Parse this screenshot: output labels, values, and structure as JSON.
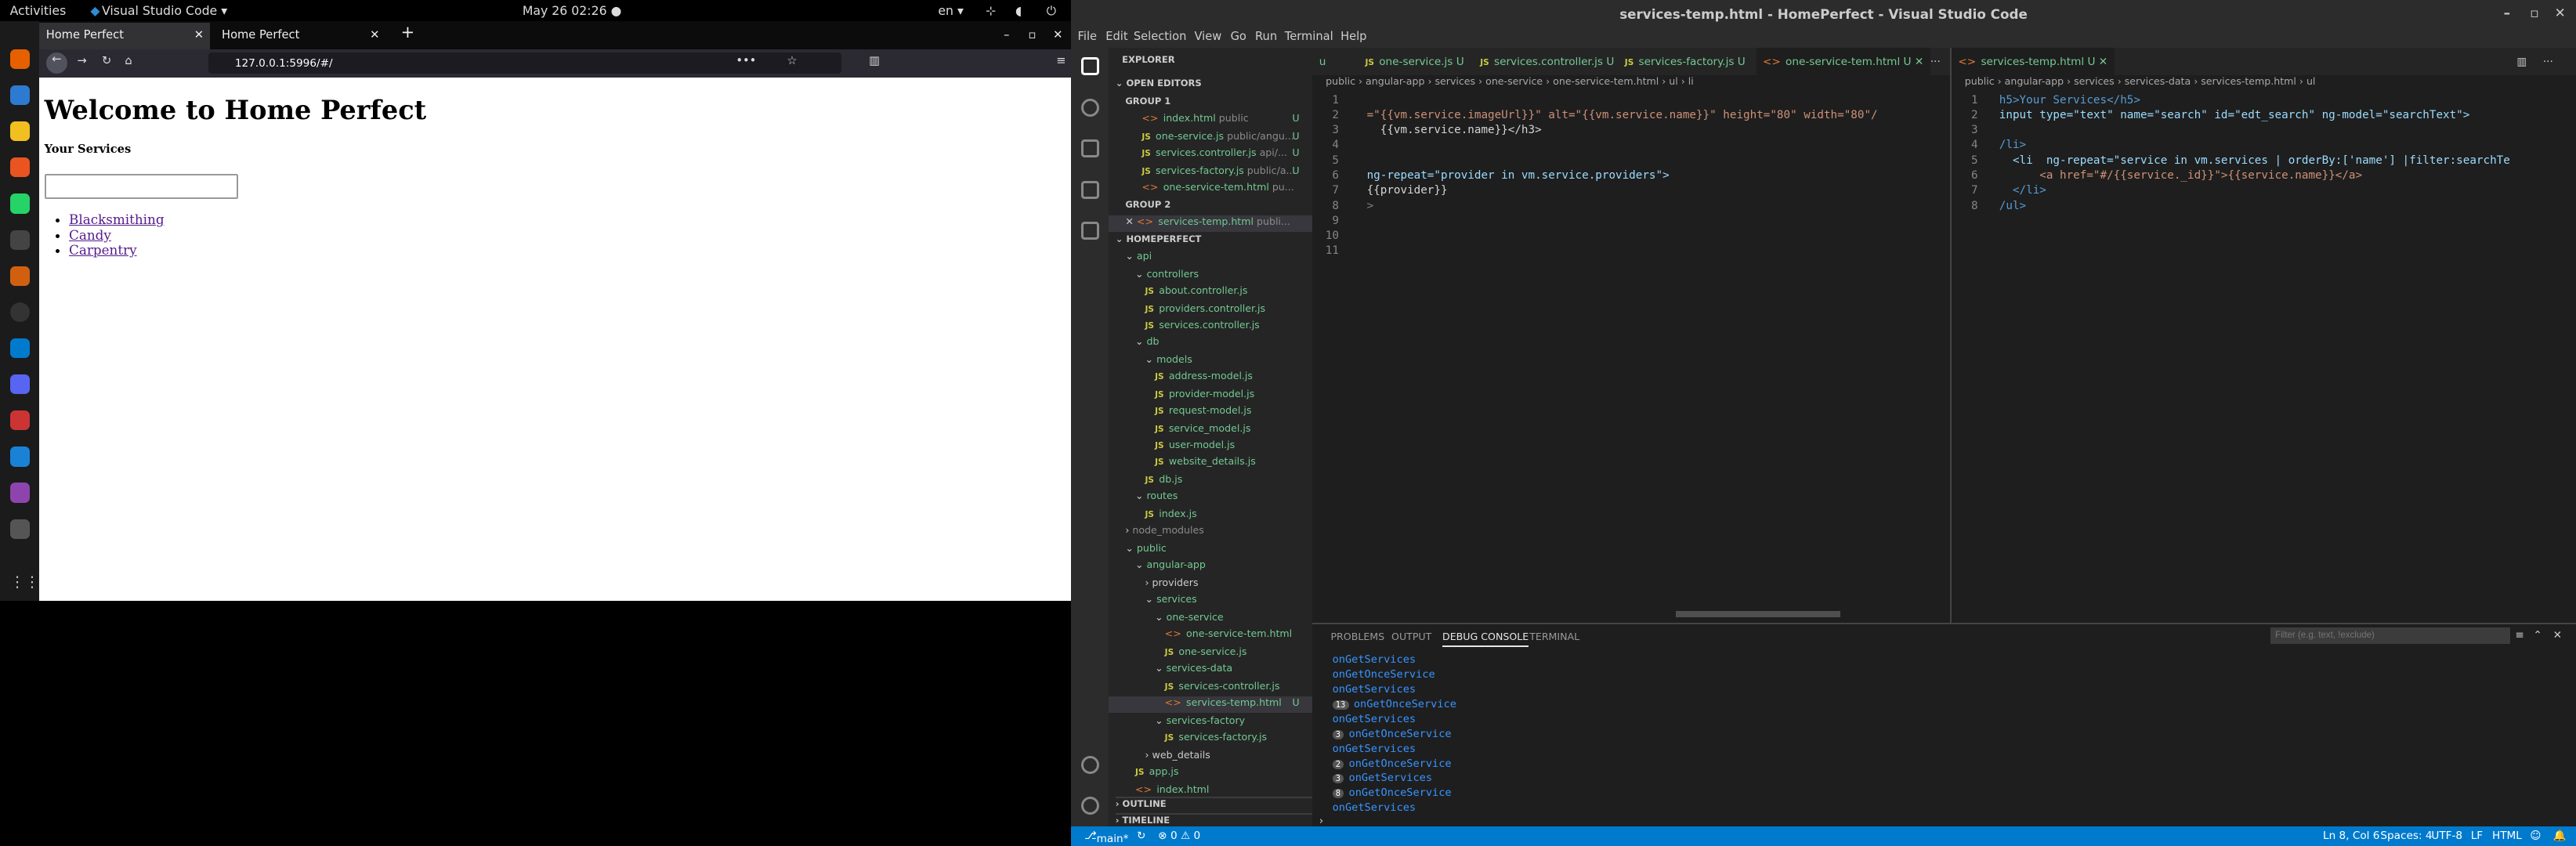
{
  "topbar": {
    "activities": "Activities",
    "app": "Visual Studio Code ▾",
    "clock": "May 26  02:26  ●",
    "lang": "en ▾"
  },
  "firefox": {
    "tabs": [
      "Home Perfect",
      "Home Perfect"
    ],
    "url": "127.0.0.1:5996/#/",
    "page": {
      "title": "Welcome to Home Perfect",
      "subtitle": "Your Services",
      "search_value": "",
      "items": [
        "Blacksmithing",
        "Candy",
        "Carpentry"
      ]
    }
  },
  "vscode": {
    "title": "services-temp.html - HomePerfect - Visual Studio Code",
    "menu": [
      "File",
      "Edit",
      "Selection",
      "View",
      "Go",
      "Run",
      "Terminal",
      "Help"
    ],
    "explorer": {
      "header": "EXPLORER",
      "open_editors": "OPEN EDITORS",
      "group1": "GROUP 1",
      "group2": "GROUP 2",
      "project": "HOMEPERFECT",
      "outline": "OUTLINE",
      "timeline": "TIMELINE",
      "g1": [
        {
          "n": "index.html",
          "d": "public"
        },
        {
          "n": "one-service.js",
          "d": "public/angu..."
        },
        {
          "n": "services.controller.js",
          "d": "api/..."
        },
        {
          "n": "services-factory.js",
          "d": "public/a..."
        },
        {
          "n": "one-service-tem.html",
          "d": "pu..."
        }
      ],
      "g2": [
        {
          "n": "services-temp.html",
          "d": "publi..."
        }
      ],
      "tree": [
        "api",
        "controllers",
        "about.controller.js",
        "providers.controller.js",
        "services.controller.js",
        "db",
        "models",
        "address-model.js",
        "provider-model.js",
        "request-model.js",
        "service_model.js",
        "user-model.js",
        "website_details.js",
        "db.js",
        "routes",
        "index.js",
        "node_modules",
        "public",
        "angular-app",
        "providers",
        "services",
        "one-service",
        "one-service-tem.html",
        "one-service.js",
        "services-data",
        "services-controller.js",
        "services-temp.html",
        "services-factory",
        "services-factory.js",
        "web_details",
        "app.js",
        "index.html"
      ]
    },
    "left_tabs": [
      "u",
      "one-service.js  U",
      "services.controller.js  U",
      "services-factory.js  U",
      "one-service-tem.html  U"
    ],
    "left_crumb": "public › angular-app › services › one-service › one-service-tem.html › ul › li",
    "left_code": [
      "",
      "=\"{{vm.service.imageUrl}}\" alt=\"{{vm.service.name}}\" height=\"80\" width=\"80\"/",
      "  {{vm.service.name}}</h3>",
      "",
      "",
      "ng-repeat=\"provider in vm.service.providers\">",
      "{{provider}}",
      ">",
      "",
      "",
      ""
    ],
    "right_tab": "services-temp.html  U",
    "right_crumb": "public › angular-app › services › services-data › services-temp.html › ul",
    "right_code": [
      "h5>Your Services</h5>",
      "input type=\"text\" name=\"search\" id=\"edt_search\" ng-model=\"searchText\">",
      "",
      "/li>",
      "  <li  ng-repeat=\"service in vm.services | orderBy:['name'] |filter:searchTe",
      "      <a href=\"#/{{service._id}}\">{{service.name}}</a>",
      "  </li>",
      "/ul>"
    ],
    "panel_tabs": [
      "PROBLEMS",
      "OUTPUT",
      "DEBUG CONSOLE",
      "TERMINAL"
    ],
    "filter_placeholder": "Filter (e.g. text, !exclude)",
    "debug": [
      {
        "b": "",
        "t": "onGetServices"
      },
      {
        "b": "",
        "t": "onGetOnceService"
      },
      {
        "b": "",
        "t": "onGetServices"
      },
      {
        "b": "13",
        "t": "onGetOnceService"
      },
      {
        "b": "",
        "t": "onGetServices"
      },
      {
        "b": "3",
        "t": "onGetOnceService"
      },
      {
        "b": "",
        "t": "onGetServices"
      },
      {
        "b": "2",
        "t": "onGetOnceService"
      },
      {
        "b": "3",
        "t": "onGetServices"
      },
      {
        "b": "8",
        "t": "onGetOnceService"
      },
      {
        "b": "",
        "t": "onGetServices"
      }
    ],
    "status": {
      "branch": "main*",
      "errors": "⊗ 0 ⚠ 0",
      "pos": "Ln 8, Col 6",
      "spaces": "Spaces: 4",
      "enc": "UTF-8",
      "eol": "LF",
      "lang": "HTML"
    }
  }
}
